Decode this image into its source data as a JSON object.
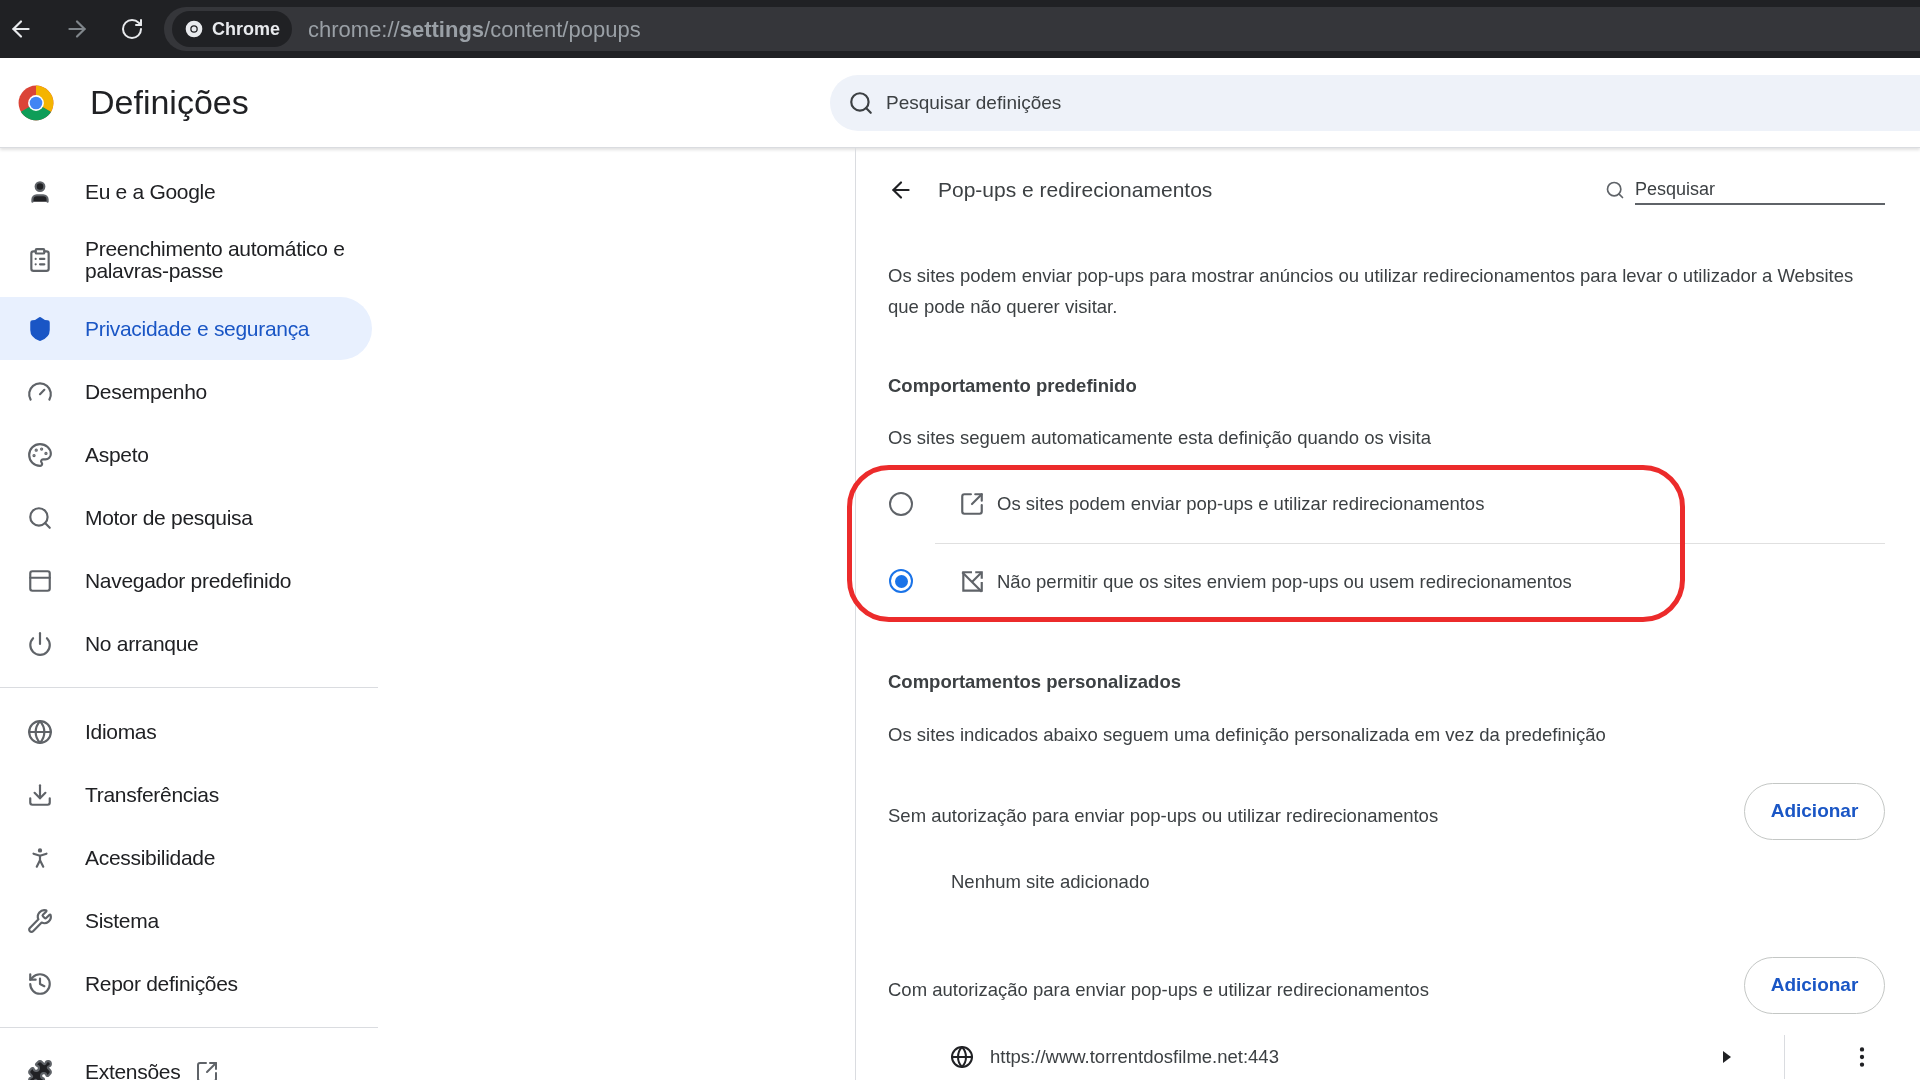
{
  "browser": {
    "chip": "Chrome",
    "url": "chrome://**settings**/content/popups"
  },
  "header": {
    "title": "Definições",
    "search": {
      "placeholder": "Pesquisar definições"
    }
  },
  "sidebar": {
    "groups": [
      [
        {
          "label": "Eu e a Google",
          "selected": false,
          "external": false
        },
        {
          "label": "Preenchimento automático e palavras-passe",
          "selected": false,
          "external": false
        },
        {
          "label": "Privacidade e segurança",
          "selected": true,
          "external": false
        },
        {
          "label": "Desempenho",
          "selected": false,
          "external": false
        },
        {
          "label": "Aspeto",
          "selected": false,
          "external": false
        },
        {
          "label": "Motor de pesquisa",
          "selected": false,
          "external": false
        },
        {
          "label": "Navegador predefinido",
          "selected": false,
          "external": false
        },
        {
          "label": "No arranque",
          "selected": false,
          "external": false
        }
      ],
      [
        {
          "label": "Idiomas",
          "selected": false,
          "external": false
        },
        {
          "label": "Transferências",
          "selected": false,
          "external": false
        },
        {
          "label": "Acessibilidade",
          "selected": false,
          "external": false
        },
        {
          "label": "Sistema",
          "selected": false,
          "external": false
        },
        {
          "label": "Repor definições",
          "selected": false,
          "external": false
        }
      ],
      [
        {
          "label": "Extensões",
          "selected": false,
          "external": true
        }
      ]
    ]
  },
  "panel": {
    "title": "Pop-ups e redirecionamentos",
    "search": {
      "placeholder": "Pesquisar"
    },
    "description": "Os sites podem enviar pop-ups para mostrar anúncios ou utilizar redirecionamentos para levar o utilizador a Websites que pode não querer visitar.",
    "default_behavior": {
      "heading": "Comportamento predefinido",
      "subtext": "Os sites seguem automaticamente esta definição quando os visita",
      "highlighted": true,
      "options": [
        {
          "label": "Os sites podem enviar pop-ups e utilizar redirecionamentos",
          "selected": false
        },
        {
          "label": "Não permitir que os sites enviem pop-ups ou usem redirecionamentos",
          "selected": true
        }
      ]
    },
    "custom_behaviors": {
      "heading": "Comportamentos personalizados",
      "subtext": "Os sites indicados abaixo seguem uma definição personalizada em vez da predefinição",
      "lists": [
        {
          "label": "Sem autorização para enviar pop-ups ou utilizar redirecionamentos",
          "button": "Adicionar",
          "empty_text": "Nenhum site adicionado"
        },
        {
          "label": "Com autorização para enviar pop-ups e utilizar redirecionamentos",
          "button": "Adicionar",
          "sites": [
            {
              "url": "https://www.torrentdosfilme.net:443"
            }
          ]
        }
      ]
    }
  }
}
